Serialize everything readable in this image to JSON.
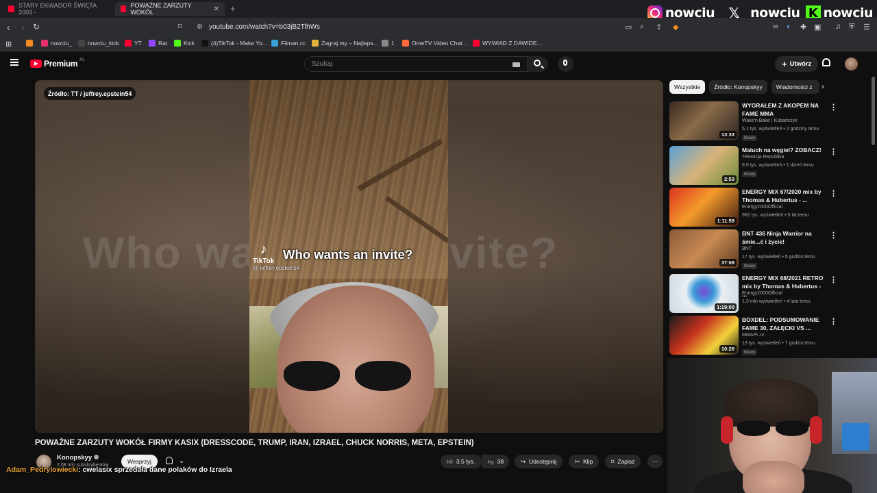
{
  "browser": {
    "tabs": [
      {
        "title": "STARY EKWADOR ŚWIĘTA 2003 -",
        "active": false
      },
      {
        "title": "POWAŻNE ZARZUTY WOKÓŁ",
        "active": true
      }
    ],
    "url": "youtube.com/watch?v=b03jB2TlhWs",
    "bookmarks": [
      {
        "label": "",
        "color": "#f58a1f"
      },
      {
        "label": "nowciu_",
        "color": "#e1306c"
      },
      {
        "label": "nowciu_kick",
        "color": "#444444"
      },
      {
        "label": "YT",
        "color": "#ff0033"
      },
      {
        "label": "Rat",
        "color": "#9146ff"
      },
      {
        "label": "Kick",
        "color": "#53fc18"
      },
      {
        "label": "(4)TikTok - Make Yo...",
        "color": "#111111"
      },
      {
        "label": "Filman.cc",
        "color": "#3aa0d8"
      },
      {
        "label": "Zagraj.my – Najleps...",
        "color": "#e0b33a"
      },
      {
        "label": "1",
        "color": "#888888"
      },
      {
        "label": "OmeTV Video Chat...",
        "color": "#ff6a3d"
      },
      {
        "label": "WYWIAD Z DAWIDE...",
        "color": "#ff0033"
      }
    ]
  },
  "overlay": {
    "instagram": "nowciu_",
    "x": "_nowciu",
    "kick": "nowciu"
  },
  "youtube": {
    "logo_text": "Premium",
    "region": "PL",
    "search_placeholder": "Szukaj",
    "create_label": "Utwórz"
  },
  "video": {
    "source_badge": "Źródło: TT / jeffrey.epstein54",
    "tiktok_label": "TikTok",
    "caption": "Who wants an invite?",
    "blurred_caption": "Who wants an invite?",
    "handle": "@ jeffrey.epstein54",
    "title": "POWAŻNE ZARZUTY WOKÓŁ FIRMY KASIX (DRESSCODE, TRUMP, IRAN, IZRAEL, CHUCK NORRIS, META, EPSTEIN)",
    "channel": "Konopskyy",
    "subscribers": "2,08 mln subskrybentów",
    "join_label": "Wesprzyj",
    "likes": "3,5 tys.",
    "dislikes": "38",
    "share_label": "Udostępnij",
    "clip_label": "Klip",
    "save_label": "Zapisz"
  },
  "chat": {
    "user": "Adam_Pedrylowiecki",
    "message": ": cwelasix sprzedała dane polaków do Izraela"
  },
  "sidebar": {
    "chips": [
      "Wszystkie",
      "Źródło: Konopskyy",
      "Wiadomości z"
    ],
    "videos": [
      {
        "title": "WYGRAŁEM Z AKOPEM NA FAME MMA",
        "channel": "Wake'n Bake | Kubańczyk",
        "meta": "5,1 tys. wyświetleń • 2 godziny temu",
        "badge": "Nowy",
        "duration": "13:33"
      },
      {
        "title": "Maluch na węgiel? ZOBACZ!",
        "channel": "Telewizja Republika",
        "meta": "9,9 tys. wyświetleń • 1 dzień temu",
        "badge": "Nowy",
        "duration": "2:53"
      },
      {
        "title": "ENERGY MIX 67/2020 mix by Thomas & Hubertus - ...",
        "channel": "Energy2000Official",
        "meta": "962 tys. wyświetleń • 5 lat temu",
        "badge": "",
        "duration": "1:11:59"
      },
      {
        "title": "BNT 436 Ninja Warrior na śmie...ć i życie!",
        "channel": "BNT",
        "meta": "17 tys. wyświetleń • 5 godzin temu",
        "badge": "Nowy",
        "duration": "37:08"
      },
      {
        "title": "ENERGY MIX 68/2021 RETRO mix by Thomas & Hubertus - ...",
        "channel": "Energy2000Official",
        "meta": "1,3 mln wyświetleń • 4 lata temu",
        "badge": "",
        "duration": "1:19:00"
      },
      {
        "title": "BOXDEL: PODSUMOWANIE FAME 30, ZAŁĘCKI VS ...",
        "channel": "MMAPL.tv",
        "meta": "13 tys. wyświetleń • 7 godzin temu",
        "badge": "Nowy",
        "duration": "10:26"
      }
    ]
  }
}
